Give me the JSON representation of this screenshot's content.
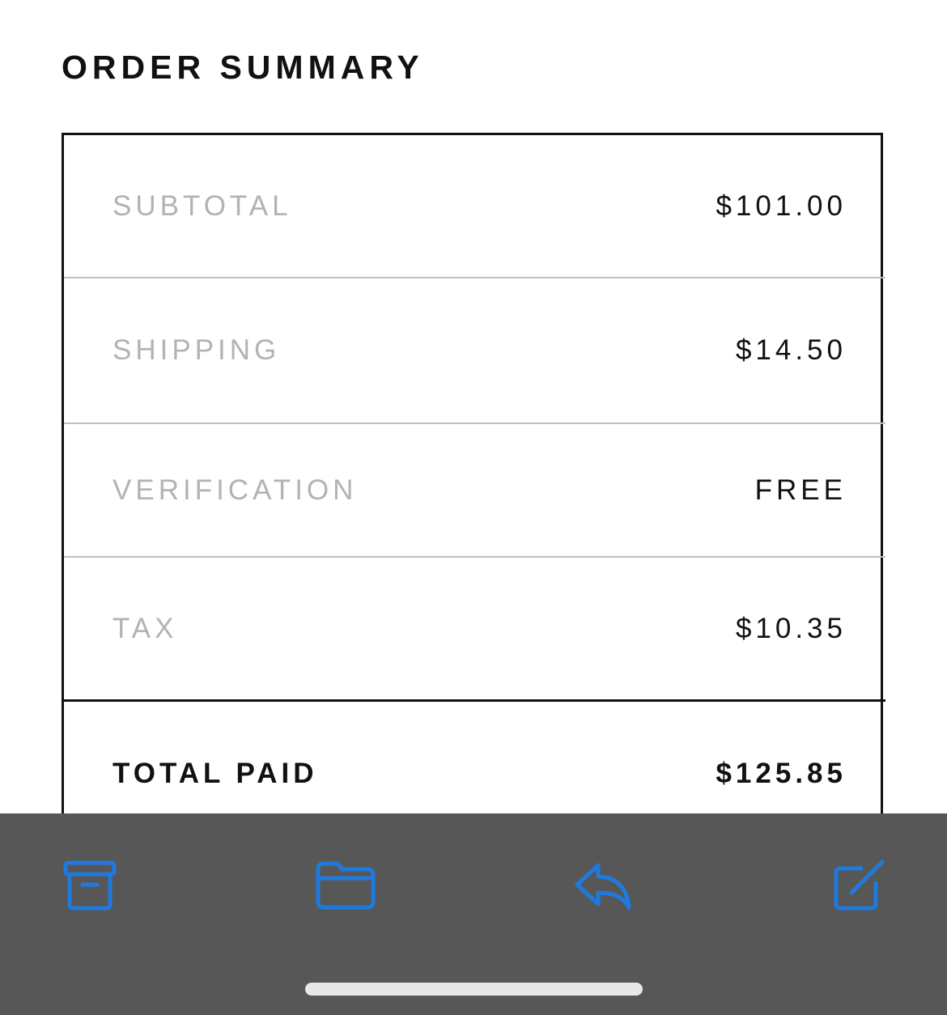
{
  "page": {
    "title": "ORDER SUMMARY"
  },
  "summary": {
    "rows": [
      {
        "label": "SUBTOTAL",
        "value": "$101.00"
      },
      {
        "label": "SHIPPING",
        "value": "$14.50"
      },
      {
        "label": "VERIFICATION",
        "value": "FREE"
      },
      {
        "label": "TAX",
        "value": "$10.35"
      }
    ],
    "total": {
      "label": "TOTAL PAID",
      "value": "$125.85"
    }
  },
  "toolbar": {
    "icons": [
      "archive-icon",
      "folder-icon",
      "reply-icon",
      "compose-icon"
    ]
  },
  "colors": {
    "accent": "#1f7ae0",
    "toolbar_bg": "#575757",
    "label_muted": "#b3b3b3",
    "text": "#111111"
  }
}
